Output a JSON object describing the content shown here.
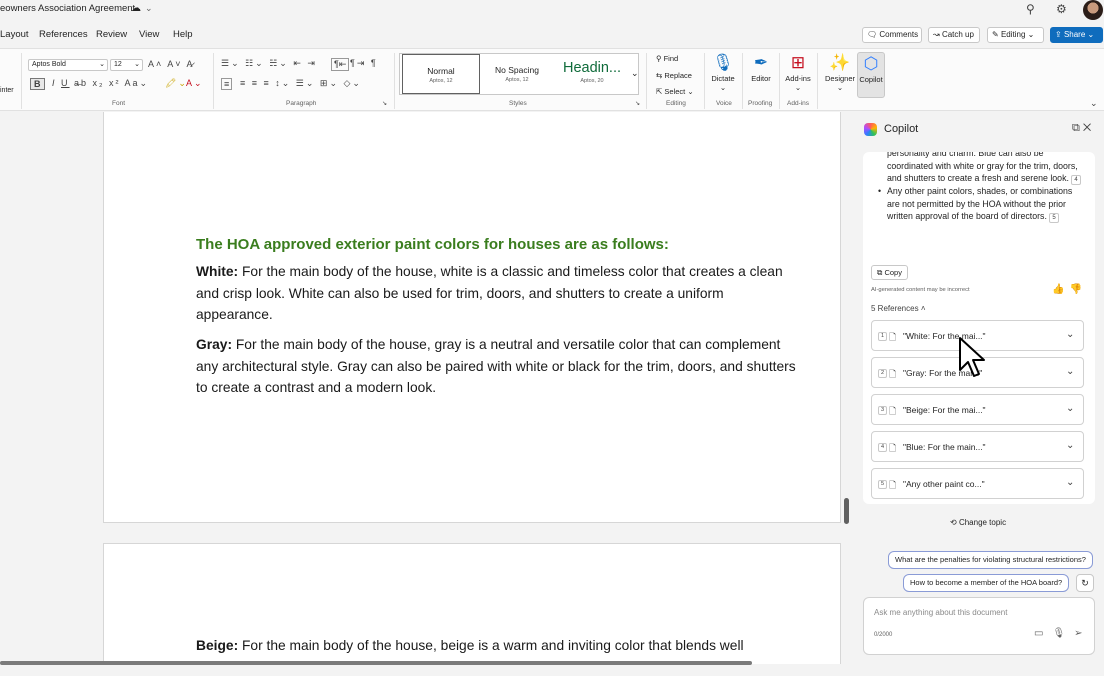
{
  "window": {
    "doc_title": "eowners Association Agreement",
    "search_icon": "search-icon",
    "settings_icon": "gear-icon"
  },
  "menu": {
    "items": [
      "Layout",
      "References",
      "Review",
      "View",
      "Help"
    ],
    "painter_label": "inter",
    "comments": "Comments",
    "catchup": "Catch up",
    "editing": "Editing",
    "share": "Share"
  },
  "ribbon": {
    "font_name": "Aptos Bold",
    "font_size": "12",
    "font_group": "Font",
    "paragraph_group": "Paragraph",
    "styles": [
      {
        "name": "Normal",
        "sub": "Aptos, 12"
      },
      {
        "name": "No Spacing",
        "sub": "Aptos, 12"
      },
      {
        "name": "Headin...",
        "sub": "Aptos, 20"
      }
    ],
    "styles_group": "Styles",
    "find": "Find",
    "replace": "Replace",
    "select": "Select",
    "editing_group": "Editing",
    "dictate": "Dictate",
    "voice_group": "Voice",
    "editor": "Editor",
    "proofing_group": "Proofing",
    "addins": "Add-ins",
    "addins_group": "Add-ins",
    "designer": "Designer",
    "copilot": "Copilot"
  },
  "document": {
    "heading": "The HOA approved exterior paint colors for houses are as follows:",
    "paragraphs": [
      {
        "label": "White:",
        "text": " For the main body of the house, white is a classic and timeless color that creates a clean and crisp look. White can also be used for trim, doors, and shutters to create a uniform appearance."
      },
      {
        "label": "Gray:",
        "text": " For the main body of the house, gray is a neutral and versatile color that can complement any architectural style. Gray can also be paired with white or black for the trim, doors, and shutters to create a contrast and a modern look."
      },
      {
        "label": "Beige:",
        "text": " For the main body of the house, beige is a warm and inviting color that blends well"
      }
    ]
  },
  "copilot": {
    "title": "Copilot",
    "bullets": [
      {
        "text": "personality and charm. Blue can also be coordinated with white or gray for the trim, doors, and shutters to create a fresh and serene look.",
        "ref": "4"
      },
      {
        "text": "Any other paint colors, shades, or combinations are not permitted by the HOA without the prior written approval of the board of directors.",
        "ref": "5"
      }
    ],
    "copy": "Copy",
    "ai_note": "AI-generated content may be incorrect",
    "references_header": "5 References",
    "references": [
      {
        "num": "1",
        "text": "\"White: For the mai...\""
      },
      {
        "num": "2",
        "text": "\"Gray: For the mai...\""
      },
      {
        "num": "3",
        "text": "\"Beige: For the mai...\""
      },
      {
        "num": "4",
        "text": "\"Blue: For the main...\""
      },
      {
        "num": "5",
        "text": "\"Any other paint co...\""
      }
    ],
    "change_topic": "Change topic",
    "suggestions": [
      "What are the penalties for violating structural restrictions?",
      "How to become a member of the HOA board?"
    ],
    "ask_placeholder": "Ask me anything about this document",
    "char_count": "0/2000"
  }
}
